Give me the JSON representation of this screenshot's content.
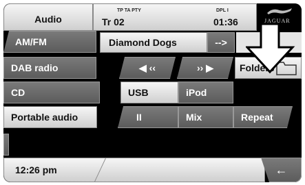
{
  "header": {
    "source": "Audio",
    "flags": "TP  TA  PTY",
    "dpl": "DPL I",
    "track": "Tr 02",
    "time": "01:36",
    "brand": "JAGUAR"
  },
  "now_playing": {
    "title": "Diamond Dogs",
    "next_label": "-->"
  },
  "sources": [
    {
      "label": "AM/FM"
    },
    {
      "label": "DAB radio"
    },
    {
      "label": "CD"
    },
    {
      "label": "Portable audio"
    }
  ],
  "controls": {
    "prev": "◀ ‹‹",
    "next": "›› ▶",
    "folders": "Folders",
    "usb": "USB",
    "ipod": "iPod",
    "pause": "II",
    "mix": "Mix",
    "repeat": "Repeat"
  },
  "footer": {
    "clock": "12:26 pm",
    "back": "←"
  }
}
